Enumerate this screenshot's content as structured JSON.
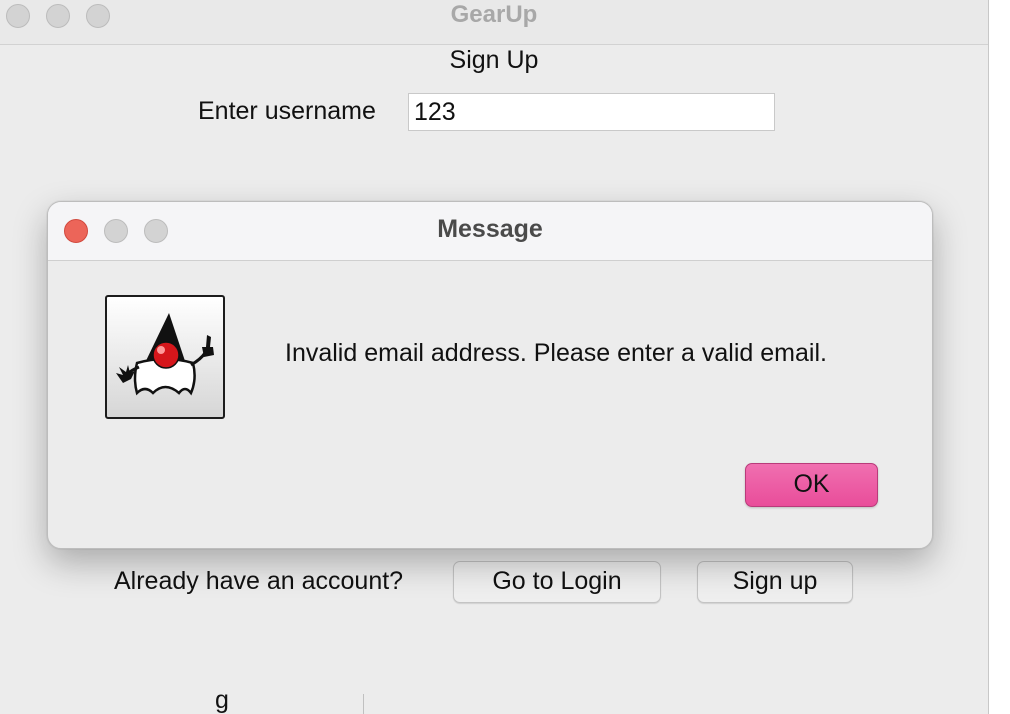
{
  "main_window": {
    "title": "GearUp",
    "heading": "Sign Up",
    "username_label": "Enter username",
    "username_value": "123",
    "already_label": "Already have an account?",
    "go_to_login_label": "Go to Login",
    "sign_up_label": "Sign up",
    "cut_text": "g"
  },
  "dialog": {
    "title": "Message",
    "message": "Invalid email address. Please enter a valid email.",
    "ok_label": "OK",
    "icon": "java-duke-icon"
  },
  "colors": {
    "window_bg": "#ececec",
    "close_red": "#ec6559",
    "ok_pink": "#e94d9a",
    "inactive_traffic": "#d3d3d3"
  }
}
